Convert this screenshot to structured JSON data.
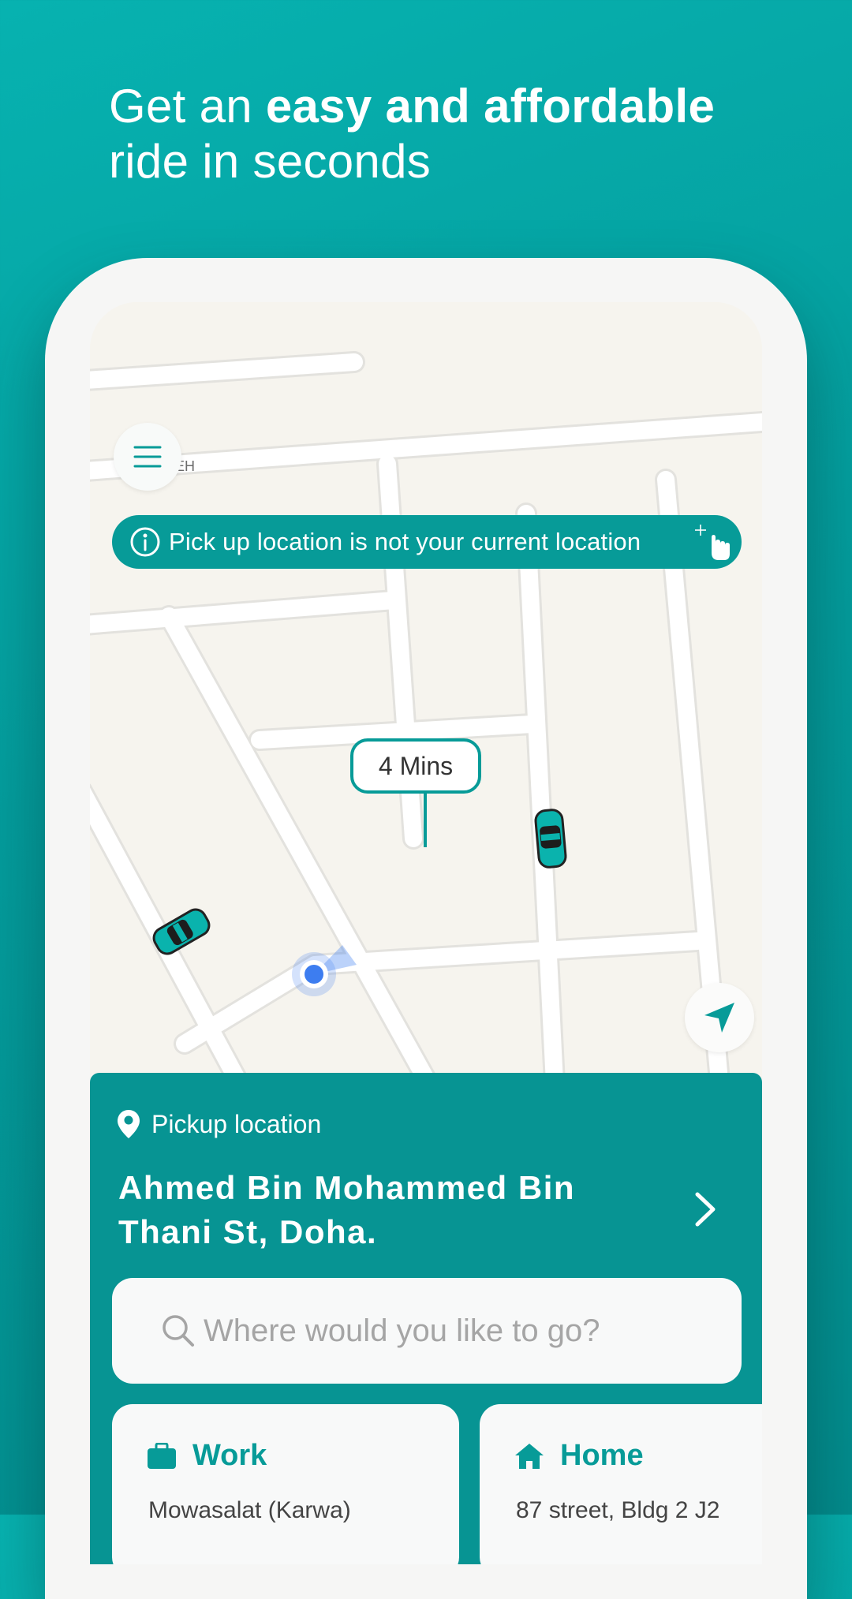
{
  "headline": {
    "prefix": "Get an ",
    "bold": "easy and affordable",
    "line2": "ride in seconds"
  },
  "map": {
    "street_fragment": "EH",
    "notice": "Pick up location is not your current location",
    "eta": "4 Mins"
  },
  "pickup": {
    "label": "Pickup location",
    "address": "Ahmed Bin Mohammed Bin Thani St, Doha."
  },
  "search": {
    "placeholder": "Where would you like to go?"
  },
  "shortcuts": [
    {
      "title": "Work",
      "subtitle": "Mowasalat (Karwa)",
      "icon": "briefcase-icon"
    },
    {
      "title": "Home",
      "subtitle": "87 street, Bldg 2 J2",
      "icon": "house-icon"
    }
  ],
  "colors": {
    "brand_teal": "#079b98",
    "panel_teal": "#079493",
    "background": "#049c9c",
    "map_land": "#f6f4ee",
    "user_dot": "#3d7df0"
  }
}
